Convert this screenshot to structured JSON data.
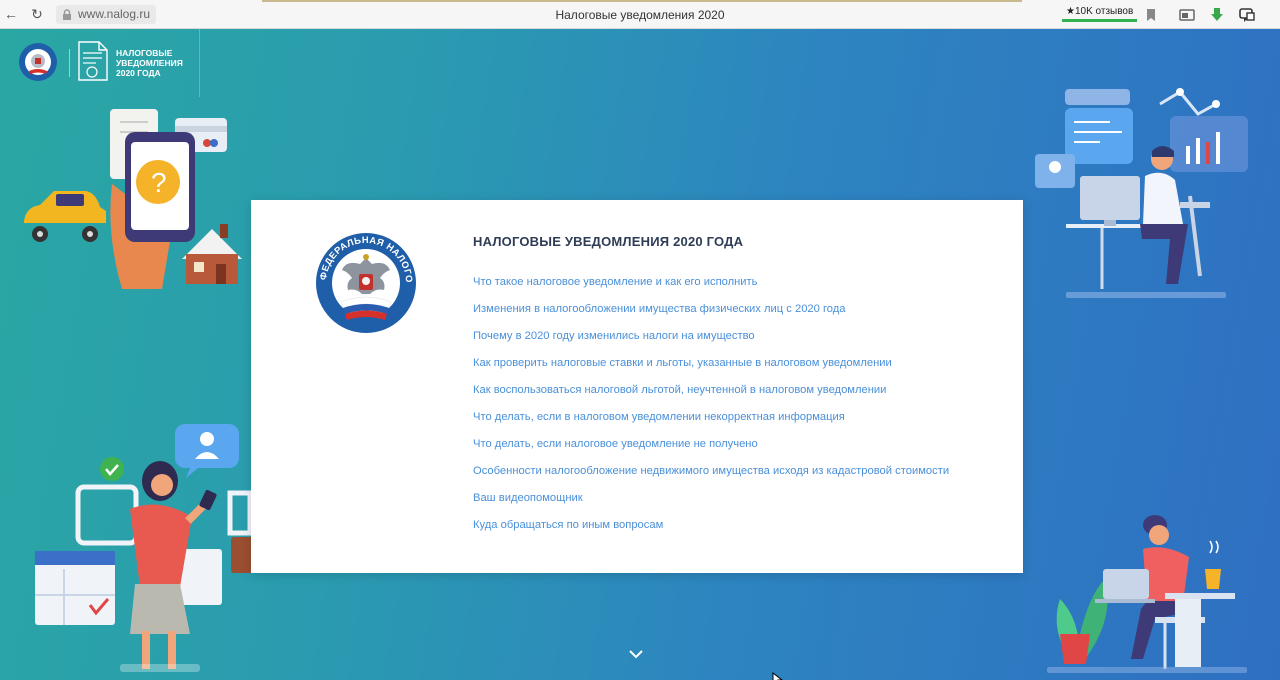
{
  "browser": {
    "url": "www.nalog.ru",
    "tab_title": "Налоговые уведомления 2020",
    "reviews_badge": "10K отзывов"
  },
  "header": {
    "title_line1": "НАЛОГОВЫЕ",
    "title_line2": "УВЕДОМЛЕНИЯ",
    "title_line3": "2020 ГОДА"
  },
  "card": {
    "title": "НАЛОГОВЫЕ УВЕДОМЛЕНИЯ 2020 ГОДА",
    "emblem_text": "ФЕДЕРАЛЬНАЯ НАЛОГОВАЯ СЛУЖБА",
    "links": [
      "Что такое налоговое уведомление и как его исполнить",
      "Изменения в налогообложении имущества физических лиц с 2020 года",
      "Почему в 2020 году изменились налоги на имущество",
      "Как проверить налоговые ставки и льготы, указанные в налоговом уведомлении",
      "Как воспользоваться налоговой льготой, неучтенной в налоговом уведомлении",
      "Что делать, если в налоговом уведомлении некорректная информация",
      "Что делать, если налоговое уведомление не получено",
      "Особенности налогообложение недвижимого имущества исходя из кадастровой стоимости",
      "Ваш видеопомощник",
      "Куда обращаться по иным вопросам"
    ]
  },
  "colors": {
    "link": "#4a90d9",
    "title": "#2e3c56",
    "bg_start": "#2aa7a3",
    "bg_end": "#2f6fc2"
  }
}
